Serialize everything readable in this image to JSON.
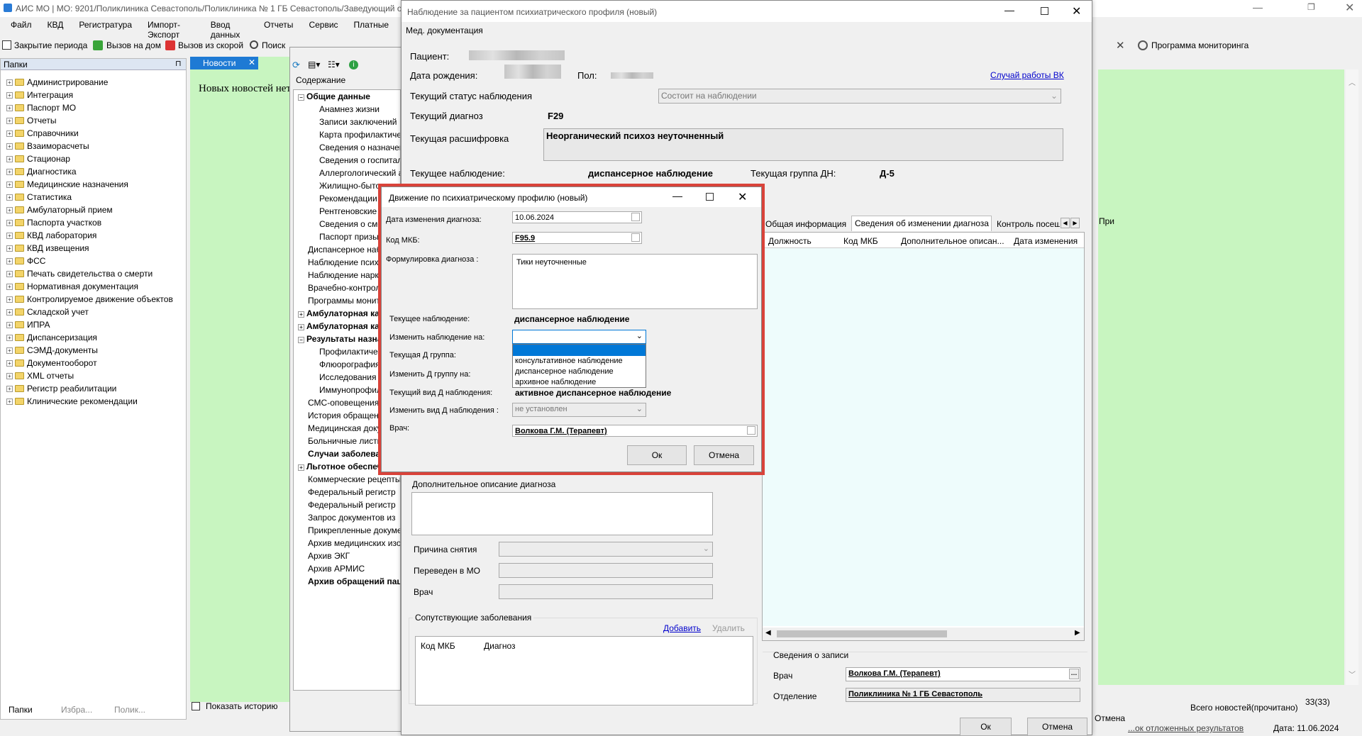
{
  "main_window": {
    "title": "АИС МО | МО: 9201/Поликлиника Севастополь/Поликлиника № 1 ГБ Севастополь/Заведующий отд..."
  },
  "menu": [
    "Файл",
    "КВД",
    "Регистратура",
    "Импорт-Экспорт",
    "Ввод данных",
    "Отчеты",
    "Сервис",
    "Платные"
  ],
  "toolbar": {
    "close_period": "Закрытие периода",
    "home_call": "Вызов на дом",
    "ambulance_call": "Вызов из скорой",
    "search": "Поиск",
    "monitoring": "Программа мониторинга"
  },
  "left_panel": {
    "title": "Папки",
    "items": [
      "Администрирование",
      "Интеграция",
      "Паспорт МО",
      "Отчеты",
      "Справочники",
      "Взаиморасчеты",
      "Стационар",
      "Диагностика",
      "Медицинские назначения",
      "Статистика",
      "Амбулаторный прием",
      "Паспорта участков",
      "КВД лаборатория",
      "КВД извещения",
      "ФСС",
      "Печать свидетельства о смерти",
      "Нормативная документация",
      "Контролируемое движение объектов",
      "Складской учет",
      "ИПРА",
      "Диспансеризация",
      "СЭМД-документы",
      "Документооборот",
      "XML отчеты",
      "Регистр реабилитации",
      "Клинические рекомендации"
    ],
    "tabs": [
      "Папки",
      "Избра...",
      "Полик..."
    ]
  },
  "news": {
    "tab": "Новости",
    "text": "Новых новостей нет",
    "show_history": "Показать историю",
    "total": "Всего новостей(прочитано)",
    "count": "33(33)"
  },
  "status_bar": {
    "link": "...ок отложенных результатов",
    "date": "Дата: 11.06.2024"
  },
  "contents": {
    "title": "Содержание",
    "items": [
      {
        "t": "Общие данные",
        "b": true,
        "lvl": 0,
        "e": "-"
      },
      {
        "t": "Анамнез жизни",
        "lvl": 1
      },
      {
        "t": "Записи заключений",
        "lvl": 1
      },
      {
        "t": "Карта профилактического",
        "lvl": 1
      },
      {
        "t": "Сведения о назначениях",
        "lvl": 1
      },
      {
        "t": "Сведения о госпитализациях",
        "lvl": 1
      },
      {
        "t": "Аллергологический анамнез",
        "lvl": 1
      },
      {
        "t": "Жилищно-бытовые",
        "lvl": 1
      },
      {
        "t": "Рекомендации",
        "lvl": 1
      },
      {
        "t": "Рентгеновские",
        "lvl": 1
      },
      {
        "t": "Сведения о смерти",
        "lvl": 1
      },
      {
        "t": "Паспорт призывника",
        "lvl": 1
      },
      {
        "t": "Диспансерное наблюдение",
        "lvl": 0
      },
      {
        "t": "Наблюдение психиатра",
        "lvl": 0
      },
      {
        "t": "Наблюдение нарколога",
        "lvl": 0
      },
      {
        "t": "Врачебно-контрольная",
        "lvl": 0
      },
      {
        "t": "Программы мониторинга",
        "lvl": 0
      },
      {
        "t": "Амбулаторная карта",
        "b": true,
        "lvl": 0,
        "e": "+"
      },
      {
        "t": "Амбулаторная карта",
        "b": true,
        "lvl": 0,
        "e": "+"
      },
      {
        "t": "Результаты назначений",
        "b": true,
        "lvl": 0,
        "e": "-"
      },
      {
        "t": "Профилактические",
        "lvl": 1
      },
      {
        "t": "Флюорография",
        "lvl": 1
      },
      {
        "t": "Исследования",
        "lvl": 1
      },
      {
        "t": "Иммунопрофилактика",
        "lvl": 1
      },
      {
        "t": "СМС-оповещения",
        "lvl": 0
      },
      {
        "t": "История обращений",
        "lvl": 0
      },
      {
        "t": "Медицинская документация",
        "lvl": 0
      },
      {
        "t": "Больничные листы",
        "lvl": 0
      },
      {
        "t": "Случаи заболеваний",
        "b": true,
        "lvl": 0
      },
      {
        "t": "Льготное обеспечение",
        "b": true,
        "lvl": 0,
        "e": "+"
      },
      {
        "t": "Коммерческие рецепты",
        "lvl": 0
      },
      {
        "t": "Федеральный регистр",
        "lvl": 0
      },
      {
        "t": "Федеральный регистр",
        "lvl": 0
      },
      {
        "t": "Запрос документов из",
        "lvl": 0
      },
      {
        "t": "Прикрепленные документы",
        "lvl": 0
      },
      {
        "t": "Архив медицинских изображений",
        "lvl": 0
      },
      {
        "t": "Архив ЭКГ",
        "lvl": 0
      },
      {
        "t": "Архив АРМИС",
        "lvl": 0
      },
      {
        "t": "Архив обращений пациента",
        "b": true,
        "lvl": 0
      }
    ]
  },
  "obs": {
    "title": "Наблюдение за пациентом психиатрического профиля (новый)",
    "menu": "Мед. документация",
    "patient_label": "Пациент:",
    "dob_label": "Дата рождения:",
    "sex_label": "Пол:",
    "vk_link": "Случай работы ВК",
    "status_label": "Текущий статус наблюдения",
    "status_value": "Состоит на наблюдении",
    "diag_label": "Текущий диагноз",
    "diag_value": "F29",
    "decode_label": "Текущая расшифровка",
    "decode_value": "Неорганический психоз неуточненный",
    "cur_obs_label": "Текущее наблюдение:",
    "cur_obs_value": "диспансерное наблюдение",
    "cur_group_label": "Текущая группа ДН:",
    "cur_group_value": "Д-5",
    "tabs": [
      "Общая информация",
      "Сведения об изменении диагноза",
      "Контроль посещений"
    ],
    "tab_extra": "При",
    "columns": [
      "Должность",
      "Код МКБ",
      "Дополнительное описан...",
      "Дата изменения"
    ],
    "extra_desc_label": "Дополнительное описание диагноза",
    "removal_label": "Причина снятия",
    "transferred_label": "Переведен в МО",
    "doctor_label": "Врач",
    "comorbid_title": "Сопутствующие заболевания",
    "add": "Добавить",
    "delete": "Удалить",
    "com_cols": [
      "Код МКБ",
      "Диагноз"
    ],
    "record_title": "Сведения о записи",
    "rec_doctor_label": "Врач",
    "rec_doctor": "Волкова Г.М. (Терапевт)",
    "rec_dept_label": "Отделение",
    "rec_dept": "Поликлиника № 1 ГБ Севастополь",
    "ok": "Ок",
    "cancel": "Отмена",
    "back_cancel": "Отмена"
  },
  "dialog": {
    "title": "Движение по психиатрическому профилю (новый)",
    "date_label": "Дата изменения диагноза:",
    "date_value": "10.06.2024",
    "mkb_label": "Код МКБ:",
    "mkb_value": "F95.9",
    "form_label": "Формулировка диагноза :",
    "form_value": "Тики неуточненные",
    "cur_obs_label": "Текущее наблюдение:",
    "cur_obs_value": "диспансерное наблюдение",
    "change_obs_label": "Изменить наблюдение на:",
    "change_obs_value": "",
    "dd_options": [
      "",
      "консультативное наблюдение",
      "диспансерное наблюдение",
      "архивное наблюдение"
    ],
    "cur_group_label": "Текущая Д группа:",
    "change_group_label": "Изменить Д группу на:",
    "cur_kind_label": "Текущий вид Д наблюдения:",
    "cur_kind_value": "активное диспансерное наблюдение",
    "change_kind_label": "Изменить вид Д наблюдения :",
    "change_kind_value": "не установлен",
    "doctor_label": "Врач:",
    "doctor_value": "Волкова Г.М. (Терапевт)",
    "ok": "Ок",
    "cancel": "Отмена"
  },
  "colors": {
    "green": "#c8f5c0",
    "highlight": "#d9433a",
    "tab_blue": "#1e7ad4",
    "select_blue": "#0078d7"
  }
}
